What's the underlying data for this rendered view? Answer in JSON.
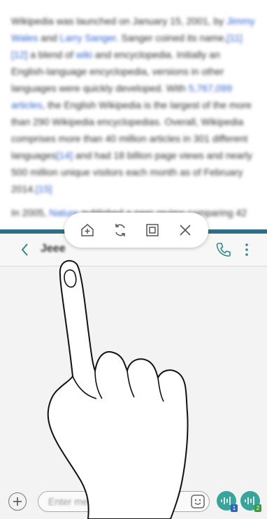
{
  "article": {
    "paragraphs": [
      [
        {
          "t": "Wikipedia was launched on January 15, 2001, by "
        },
        {
          "t": "Jimmy Wales",
          "link": true
        },
        {
          "t": " and "
        },
        {
          "t": "Larry Sanger",
          "link": true
        },
        {
          "t": ". Sanger coined its name,"
        },
        {
          "t": "[11][12]",
          "link": true
        },
        {
          "t": " a blend of "
        },
        {
          "t": "wiki",
          "link": true
        },
        {
          "t": " and encyclopedia. Initially an English-language encyclopedia, versions in other languages were quickly developed. With "
        },
        {
          "t": "5,767,099 articles",
          "link": true
        },
        {
          "t": ", the English Wikipedia is the largest of the more than 290 Wikipedia encyclopedias. Overall, Wikipedia comprises more than 40 million articles in 301 different languages"
        },
        {
          "t": "[14]",
          "link": true
        },
        {
          "t": " and had 18 billion page views and nearly 500 million unique visitors each month as of February 2014."
        },
        {
          "t": "[15]",
          "link": true
        }
      ],
      [
        {
          "t": "In 2005, "
        },
        {
          "t": "Nature",
          "link": true
        },
        {
          "t": " published a peer review comparing 42"
        }
      ]
    ]
  },
  "chat": {
    "contact_name": "Jeee",
    "input_placeholder": "Enter message"
  },
  "send_buttons": [
    {
      "sim": "1",
      "badge_color": "#2a66b8"
    },
    {
      "sim": "2",
      "badge_color": "#3c9a3c"
    }
  ],
  "icons": {
    "control_bar": [
      "add-to-home-icon",
      "swap-windows-icon",
      "window-mode-icon",
      "close-icon"
    ],
    "header": [
      "back-icon",
      "call-icon",
      "more-icon"
    ],
    "input": [
      "add-icon",
      "sticker-icon",
      "voice-send-icon"
    ]
  },
  "colors": {
    "divider": "#2f6f86",
    "accent": "#3aa39a",
    "link": "#2f5fd0"
  }
}
